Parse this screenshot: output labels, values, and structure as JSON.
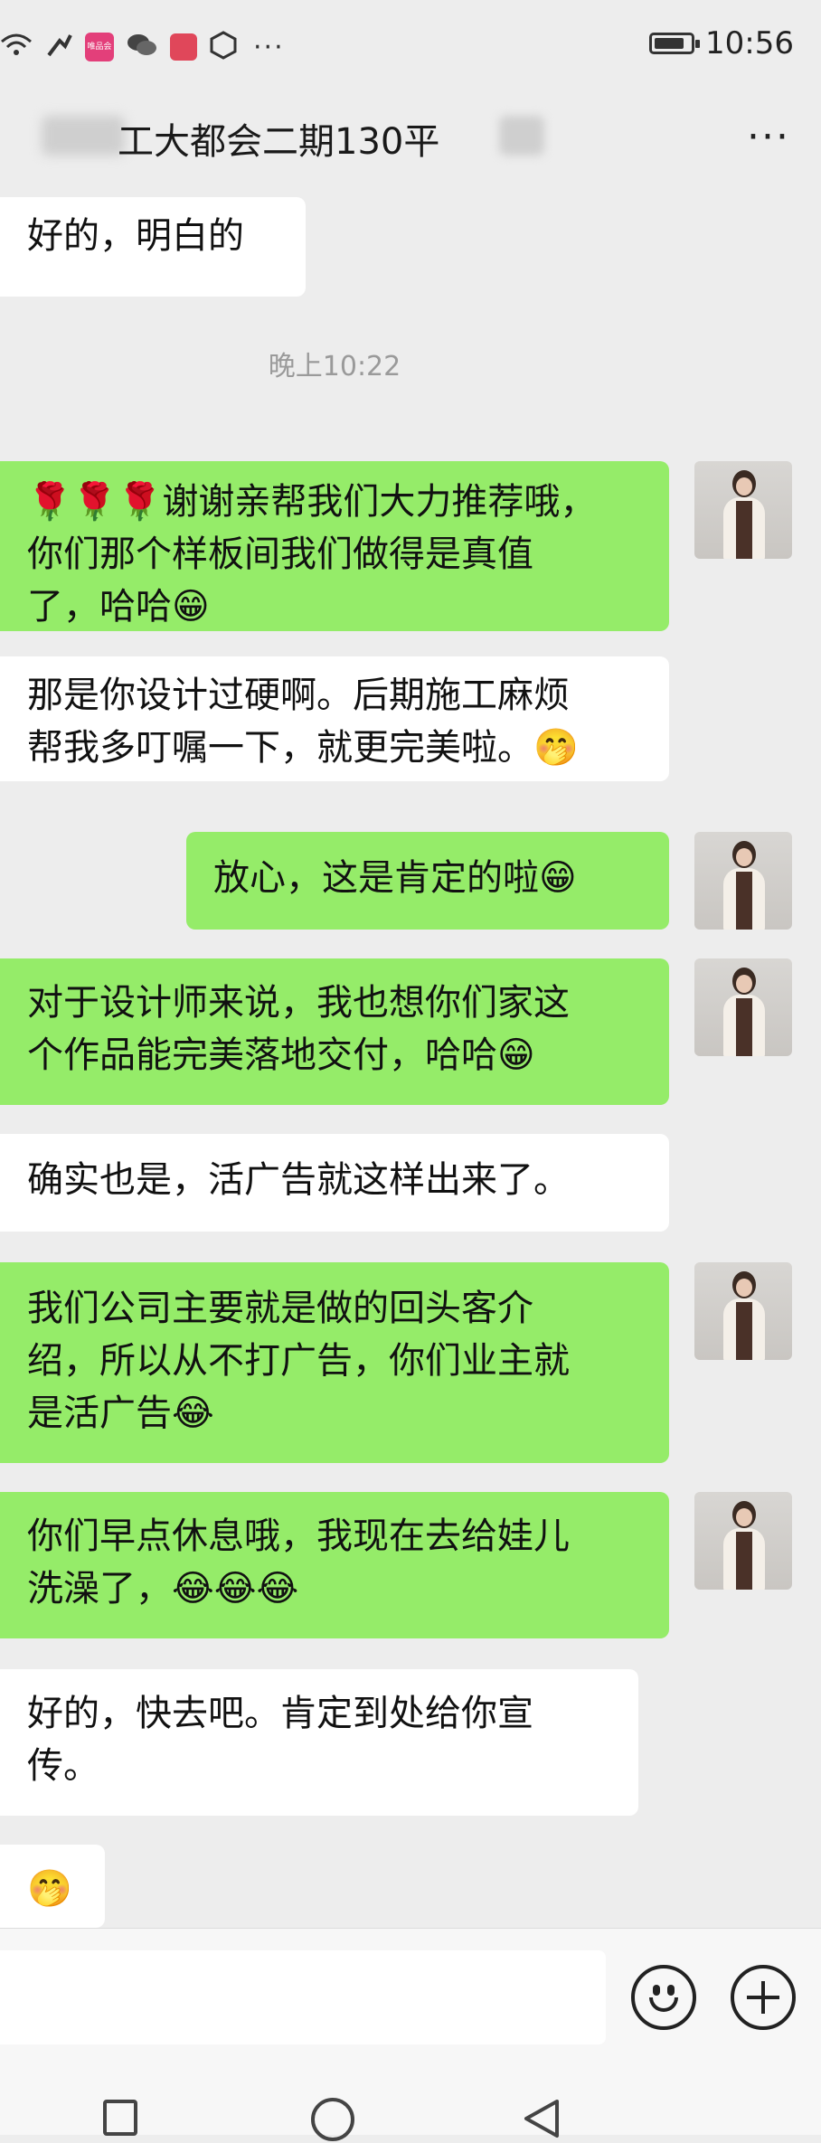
{
  "status_bar": {
    "time": "10:56",
    "app_badge_text": "唯品会",
    "icons": [
      "wifi-icon",
      "signal-icon",
      "vipshop-app-icon",
      "wechat-icon",
      "red-app-icon",
      "hexagon-app-icon",
      "more-dots-icon",
      "battery-icon"
    ],
    "more": "···",
    "battery_level": 0.85
  },
  "header": {
    "title": "工大都会二期130平",
    "more": "···"
  },
  "timestamp": "晚上10:22",
  "messages": [
    {
      "side": "in",
      "text": "好的，明白的"
    },
    {
      "side": "out",
      "text": "🌹🌹🌹谢谢亲帮我们大力推荐哦，\n你们那个样板间我们做得是真值\n了，哈哈😁"
    },
    {
      "side": "in",
      "text": "那是你设计过硬啊。后期施工麻烦\n帮我多叮嘱一下，就更完美啦。🤭"
    },
    {
      "side": "out",
      "text": "放心，这是肯定的啦😁"
    },
    {
      "side": "out",
      "text": "对于设计师来说，我也想你们家这\n个作品能完美落地交付，哈哈😁"
    },
    {
      "side": "in",
      "text": "确实也是，活广告就这样出来了。"
    },
    {
      "side": "out",
      "text": "我们公司主要就是做的回头客介\n绍，所以从不打广告，你们业主就\n是活广告😂"
    },
    {
      "side": "out",
      "text": "你们早点休息哦，我现在去给娃儿\n洗澡了，😂😂😂"
    },
    {
      "side": "in",
      "text": "好的，快去吧。肯定到处给你宣\n传。"
    },
    {
      "side": "in",
      "text": "🤭"
    }
  ],
  "input_bar": {
    "emoji_icon": "smiley-icon",
    "plus_icon": "plus-icon"
  },
  "nav_bar": {
    "icons": [
      "recent-apps-icon",
      "home-icon",
      "back-icon"
    ]
  },
  "colors": {
    "background": "#ededed",
    "outgoing_bubble": "#95ec69",
    "incoming_bubble": "#ffffff"
  }
}
